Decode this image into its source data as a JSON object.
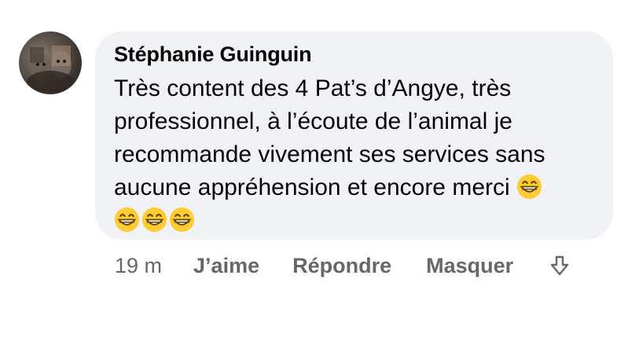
{
  "comment": {
    "author": "Stéphanie Guinguin",
    "text_lines": [
      "Très content des 4 Pat’s d’Angye, très",
      "professionnel, à l’écoute de l’animal je",
      "recommande vivement ses services sans",
      "aucune appréhension et encore merci"
    ],
    "emoji_name": "grinning-face-with-smiling-eyes"
  },
  "actions": {
    "time": "19 m",
    "like_label": "J’aime",
    "reply_label": "Répondre",
    "hide_label": "Masquer",
    "more_icon": "arrow-down-outline-icon"
  },
  "colors": {
    "bubble": "#f0f2f5",
    "text": "#050505",
    "secondary": "#65676b",
    "emoji": "#ffcc33"
  }
}
